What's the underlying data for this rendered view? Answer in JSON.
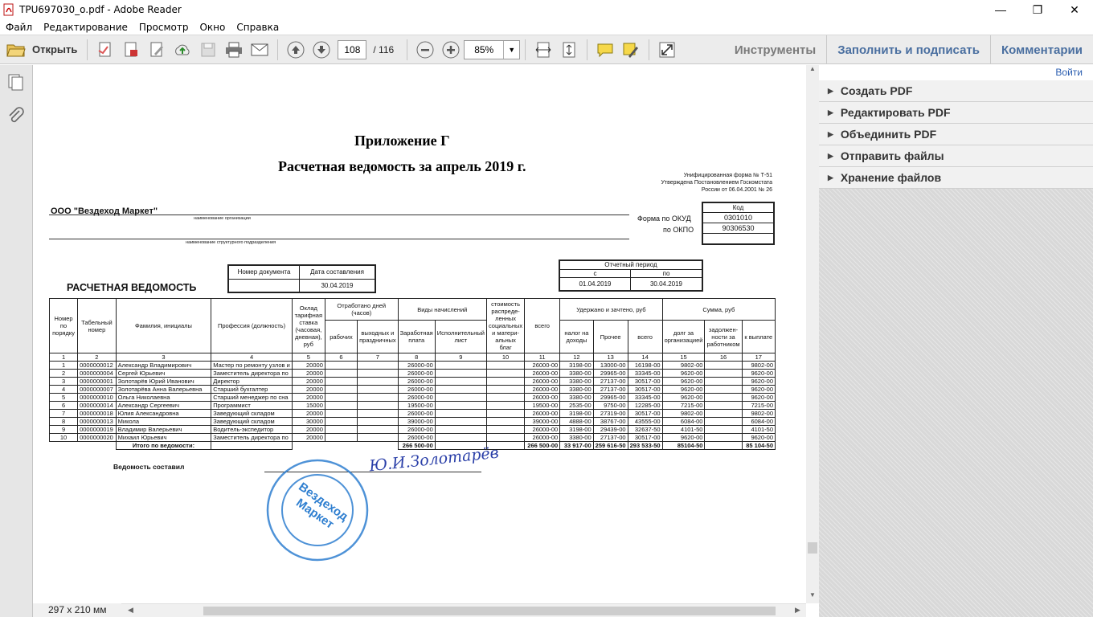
{
  "window": {
    "title": "TPU697030_o.pdf - Adobe Reader"
  },
  "menu": [
    "Файл",
    "Редактирование",
    "Просмотр",
    "Окно",
    "Справка"
  ],
  "toolbar": {
    "open_label": "Открыть",
    "page_current": "108",
    "page_total": "/  116",
    "zoom": "85%",
    "tools": "Инструменты",
    "fill_sign": "Заполнить и подписать",
    "comments": "Комментарии"
  },
  "right_panel": {
    "login": "Войти",
    "items": [
      "Создать PDF",
      "Редактировать PDF",
      "Объединить PDF",
      "Отправить файлы",
      "Хранение файлов"
    ]
  },
  "status": {
    "page_size": "297 x 210 мм"
  },
  "document": {
    "appendix": "Приложение Г",
    "title": "Расчетная ведомость за апрель 2019 г.",
    "form_note": [
      "Унифицированная форма № Т-51",
      "Утверждена Постановлением Госкомстата",
      "России от 06.04.2001 № 26"
    ],
    "org": "ООО \"Вездеход Маркет\"",
    "org_caption": "наименование организации",
    "dept_caption": "наименование структурного подразделения",
    "code_header": "Код",
    "okud_label": "Форма по ОКУД",
    "okud": "0301010",
    "okpo_label": "по ОКПО",
    "okpo": "90306530",
    "doc_number_label": "Номер документа",
    "doc_date_label": "Дата составления",
    "doc_date": "30.04.2019",
    "sheet_title": "РАСЧЕТНАЯ ВЕДОМОСТЬ",
    "period_label": "Отчетный период",
    "period_from_label": "с",
    "period_to_label": "по",
    "period_from": "01.04.2019",
    "period_to": "30.04.2019",
    "headers": {
      "num": "Номер по порядку",
      "tab": "Табельный номер",
      "name": "Фамилия, инициалы",
      "prof": "Профессия (должность)",
      "rate": "Оклад тарифная ставка (часовая, дневная), руб",
      "worked": "Отработано дней (часов)",
      "work_days": "рабочих",
      "holidays": "выходных и праздничных",
      "accruals": "Виды начислений",
      "salary": "Заработная плата",
      "exec": "Исполнительный лист",
      "social": "стоимость распреде-ленных социальных и матери-альных благ",
      "total": "всего",
      "withheld": "Удержано и зачтено, руб",
      "ndfl": "налог на доходы",
      "other": "Прочее",
      "wtotal": "всего",
      "sum": "Сумма, руб",
      "org_debt": "долг за организацией",
      "emp_debt": "задолжен-ности за работником",
      "pay": "к выплате"
    },
    "colnums": [
      "1",
      "2",
      "3",
      "4",
      "5",
      "6",
      "7",
      "8",
      "9",
      "10",
      "11",
      "12",
      "13",
      "14",
      "15",
      "16",
      "17"
    ],
    "rows": [
      [
        "1",
        "0000000012",
        "Александр Владимирович",
        "Мастер по ремонту узлов и",
        "20000",
        "",
        "",
        "26000-00",
        "",
        "",
        "26000-00",
        "3198-00",
        "13000-00",
        "16198-00",
        "9802-00",
        "",
        "9802-00"
      ],
      [
        "2",
        "0000000004",
        "Сергей Юрьевич",
        "Заместитель директора по",
        "20000",
        "",
        "",
        "26000-00",
        "",
        "",
        "26000-00",
        "3380-00",
        "29965-00",
        "33345-00",
        "9620-00",
        "",
        "9620-00"
      ],
      [
        "3",
        "0000000001",
        "Золотарёв Юрий Иванович",
        "Директор",
        "20000",
        "",
        "",
        "26000-00",
        "",
        "",
        "26000-00",
        "3380-00",
        "27137-00",
        "30517-00",
        "9620-00",
        "",
        "9620-00"
      ],
      [
        "4",
        "0000000007",
        "Золотарёва Анна Валерьевна",
        "Старший бухгалтер",
        "20000",
        "",
        "",
        "26000-00",
        "",
        "",
        "26000-00",
        "3380-00",
        "27137-00",
        "30517-00",
        "9620-00",
        "",
        "9620-00"
      ],
      [
        "5",
        "0000000010",
        "Ольга Николаевна",
        "Старший менеджер по сна",
        "20000",
        "",
        "",
        "26000-00",
        "",
        "",
        "26000-00",
        "3380-00",
        "29965-00",
        "33345-00",
        "9620-00",
        "",
        "9620-00"
      ],
      [
        "6",
        "0000000014",
        "Александр Сергеевич",
        "Программист",
        "15000",
        "",
        "",
        "19500-00",
        "",
        "",
        "19500-00",
        "2535-00",
        "9750-00",
        "12285-00",
        "7215-00",
        "",
        "7215-00"
      ],
      [
        "7",
        "0000000018",
        "Юлия Александровна",
        "Заведующий складом",
        "20000",
        "",
        "",
        "26000-00",
        "",
        "",
        "26000-00",
        "3198-00",
        "27319-00",
        "30517-00",
        "9802-00",
        "",
        "9802-00"
      ],
      [
        "8",
        "0000000013",
        "Микола",
        "Заведующий складом",
        "30000",
        "",
        "",
        "39000-00",
        "",
        "",
        "39000-00",
        "4888-00",
        "38767-00",
        "43555-00",
        "6084-00",
        "",
        "6084-00"
      ],
      [
        "9",
        "0000000019",
        "Владимир Валерьевич",
        "Водитель-экспедитор",
        "20000",
        "",
        "",
        "26000-00",
        "",
        "",
        "26000-00",
        "3198-00",
        "29439-00",
        "32637-50",
        "4101-50",
        "",
        "4101-50"
      ],
      [
        "10",
        "0000000020",
        "Михаил Юрьевич",
        "Заместитель директора по",
        "20000",
        "",
        "",
        "26000-00",
        "",
        "",
        "26000-00",
        "3380-00",
        "27137-00",
        "30517-00",
        "9620-00",
        "",
        "9620-00"
      ]
    ],
    "totals_label": "Итого по ведомости:",
    "totals": {
      "salary": "266 500-00",
      "total": "266 500-00",
      "ndfl": "33 917-00",
      "other": "259 616-50",
      "wtotal": "293 533-50",
      "org_debt": "85104-50",
      "pay": "85 104-50"
    },
    "compiled_by": "Ведомость составил",
    "signature": "Ю.И.Золотарёв",
    "stamp_text": [
      "ОБЩЕСТВО С ОГРАНИЧЕННОЙ ОТВЕТСТВЕННОСТЬЮ",
      "Вездеход Маркет",
      "ДЛЯ ДОКУМЕНТОВ",
      "РОССИЯ · ТОМСК",
      "ОГРН 1117017011275 ИНН 7017287516"
    ]
  }
}
